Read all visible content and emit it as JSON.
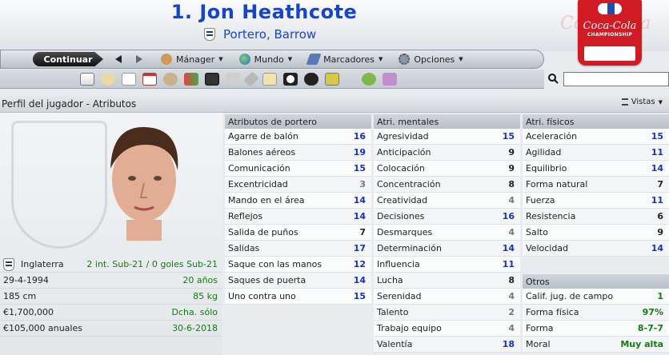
{
  "header": {
    "player_name": "1. Jon Heathcote",
    "subtitle": "Portero, Barrow",
    "competition_watermark": "Coca-Cola",
    "competition_logo_text": "Coca-Cola",
    "competition_logo_sub": "CHAMPIONSHIP"
  },
  "nav": {
    "continue_label": "Continuar",
    "manager_label": "Mánager",
    "world_label": "Mundo",
    "bookmarks_label": "Marcadores",
    "options_label": "Opciones"
  },
  "search": {
    "value": ""
  },
  "section": {
    "title": "Perfil del jugador - Atributos",
    "views_label": "Vistas"
  },
  "profile": {
    "nationality": "Inglaterra",
    "international": "2 int. Sub-21 / 0 goles Sub-21",
    "birth_date": "29-4-1994",
    "age": "20 años",
    "height": "185 cm",
    "weight": "85 kg",
    "value": "€1,700,000",
    "foot": "Dcha. sólo",
    "wage": "€105,000 anuales",
    "contract_end": "30-6-2018"
  },
  "goalkeeper": {
    "title": "Atributos de portero",
    "rows": [
      {
        "label": "Agarre de balón",
        "value": "16"
      },
      {
        "label": "Balones aéreos",
        "value": "19"
      },
      {
        "label": "Comunicación",
        "value": "15"
      },
      {
        "label": "Excentricidad",
        "value": "3"
      },
      {
        "label": "Mando en el área",
        "value": "14"
      },
      {
        "label": "Reflejos",
        "value": "14"
      },
      {
        "label": "Salida de puños",
        "value": "7"
      },
      {
        "label": "Salidas",
        "value": "17"
      },
      {
        "label": "Saque con las manos",
        "value": "12"
      },
      {
        "label": "Saques de puerta",
        "value": "14"
      },
      {
        "label": "Uno contra uno",
        "value": "15"
      }
    ]
  },
  "mental": {
    "title": "Atri. mentales",
    "rows": [
      {
        "label": "Agresividad",
        "value": "15"
      },
      {
        "label": "Anticipación",
        "value": "9"
      },
      {
        "label": "Colocación",
        "value": "9"
      },
      {
        "label": "Concentración",
        "value": "8"
      },
      {
        "label": "Creatividad",
        "value": "4"
      },
      {
        "label": "Decisiones",
        "value": "16"
      },
      {
        "label": "Desmarques",
        "value": "4"
      },
      {
        "label": "Determinación",
        "value": "14"
      },
      {
        "label": "Influencia",
        "value": "11"
      },
      {
        "label": "Lucha",
        "value": "8"
      },
      {
        "label": "Serenidad",
        "value": "4"
      },
      {
        "label": "Talento",
        "value": "2"
      },
      {
        "label": "Trabajo equipo",
        "value": "4"
      },
      {
        "label": "Valentía",
        "value": "18"
      }
    ]
  },
  "physical": {
    "title": "Atri. físicos",
    "rows": [
      {
        "label": "Aceleración",
        "value": "15"
      },
      {
        "label": "Agilidad",
        "value": "11"
      },
      {
        "label": "Equilibrio",
        "value": "14"
      },
      {
        "label": "Forma natural",
        "value": "7"
      },
      {
        "label": "Fuerza",
        "value": "11"
      },
      {
        "label": "Resistencia",
        "value": "6"
      },
      {
        "label": "Salto",
        "value": "9"
      },
      {
        "label": "Velocidad",
        "value": "14"
      }
    ]
  },
  "others": {
    "title": "Otros",
    "rows": [
      {
        "label": "Calif. jug. de campo",
        "value": "1"
      },
      {
        "label": "Forma física",
        "value": "97%"
      },
      {
        "label": "Forma",
        "value": "8-7-7"
      },
      {
        "label": "Moral",
        "value": "Muy alta"
      }
    ]
  },
  "colors": {
    "accent_blue": "#1a44c8",
    "value_blue": "#1830c8",
    "value_green": "#157a15",
    "value_gray": "#777777"
  }
}
